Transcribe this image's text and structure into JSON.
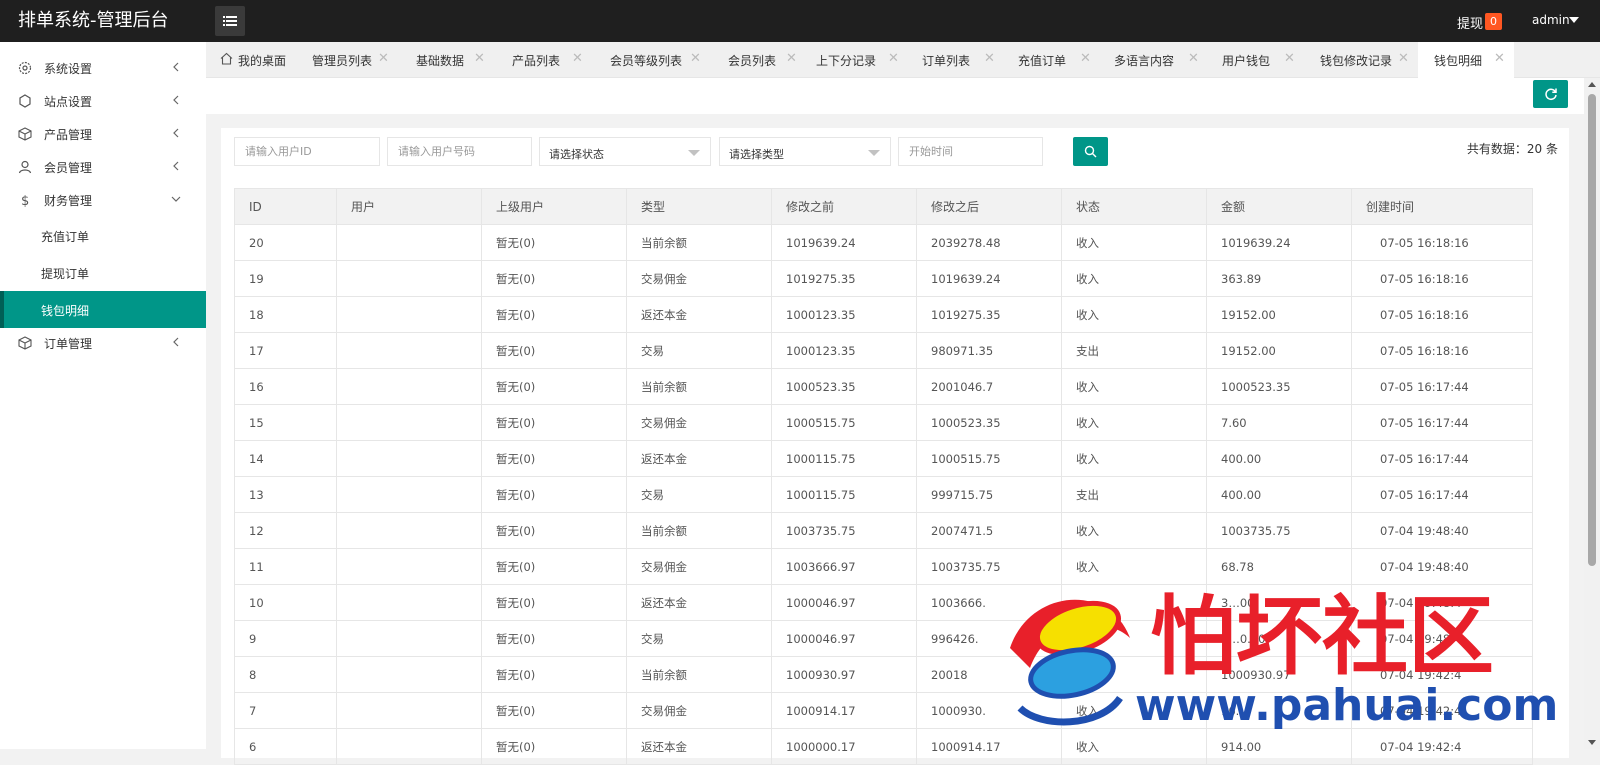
{
  "app": {
    "title": "排单系统-管理后台",
    "withdraw_label": "提现",
    "withdraw_count": "0",
    "user": "admin"
  },
  "sidebar": {
    "items": [
      {
        "label": "系统设置",
        "icon": "gear-icon"
      },
      {
        "label": "站点设置",
        "icon": "site-icon"
      },
      {
        "label": "产品管理",
        "icon": "box-icon"
      },
      {
        "label": "会员管理",
        "icon": "user-icon"
      },
      {
        "label": "财务管理",
        "icon": "dollar-icon"
      },
      {
        "label": "订单管理",
        "icon": "box-icon"
      }
    ],
    "finance_sub": [
      {
        "label": "充值订单"
      },
      {
        "label": "提现订单"
      },
      {
        "label": "钱包明细"
      }
    ]
  },
  "tabs": [
    {
      "label": "我的桌面"
    },
    {
      "label": "管理员列表"
    },
    {
      "label": "基础数据"
    },
    {
      "label": "产品列表"
    },
    {
      "label": "会员等级列表"
    },
    {
      "label": "会员列表"
    },
    {
      "label": "上下分记录"
    },
    {
      "label": "订单列表"
    },
    {
      "label": "充值订单"
    },
    {
      "label": "多语言内容"
    },
    {
      "label": "用户钱包"
    },
    {
      "label": "钱包修改记录"
    },
    {
      "label": "钱包明细"
    }
  ],
  "filters": {
    "user_id_placeholder": "请输入用户ID",
    "user_phone_placeholder": "请输入用户号码",
    "status_select": "请选择状态",
    "type_select": "请选择类型",
    "start_time_placeholder": "开始时间",
    "total_label": "共有数据：",
    "total_value": "20 条"
  },
  "table": {
    "columns": [
      "ID",
      "用户",
      "上级用户",
      "类型",
      "修改之前",
      "修改之后",
      "状态",
      "金额",
      "创建时间"
    ],
    "rows": [
      [
        "20",
        "",
        "暂无(0)",
        "当前余额",
        "1019639.24",
        "2039278.48",
        "收入",
        "1019639.24",
        "07-05 16:18:16"
      ],
      [
        "19",
        "",
        "暂无(0)",
        "交易佣金",
        "1019275.35",
        "1019639.24",
        "收入",
        "363.89",
        "07-05 16:18:16"
      ],
      [
        "18",
        "",
        "暂无(0)",
        "返还本金",
        "1000123.35",
        "1019275.35",
        "收入",
        "19152.00",
        "07-05 16:18:16"
      ],
      [
        "17",
        "",
        "暂无(0)",
        "交易",
        "1000123.35",
        "980971.35",
        "支出",
        "19152.00",
        "07-05 16:18:16"
      ],
      [
        "16",
        "",
        "暂无(0)",
        "当前余额",
        "1000523.35",
        "2001046.7",
        "收入",
        "1000523.35",
        "07-05 16:17:44"
      ],
      [
        "15",
        "",
        "暂无(0)",
        "交易佣金",
        "1000515.75",
        "1000523.35",
        "收入",
        "7.60",
        "07-05 16:17:44"
      ],
      [
        "14",
        "",
        "暂无(0)",
        "返还本金",
        "1000115.75",
        "1000515.75",
        "收入",
        "400.00",
        "07-05 16:17:44"
      ],
      [
        "13",
        "",
        "暂无(0)",
        "交易",
        "1000115.75",
        "999715.75",
        "支出",
        "400.00",
        "07-05 16:17:44"
      ],
      [
        "12",
        "",
        "暂无(0)",
        "当前余额",
        "1003735.75",
        "2007471.5",
        "收入",
        "1003735.75",
        "07-04 19:48:40"
      ],
      [
        "11",
        "",
        "暂无(0)",
        "交易佣金",
        "1003666.97",
        "1003735.75",
        "收入",
        "68.78",
        "07-04 19:48:40"
      ],
      [
        "10",
        "",
        "暂无(0)",
        "返还本金",
        "1000046.97",
        "1003666.",
        "",
        "3…00",
        "07-04 19:48:4"
      ],
      [
        "9",
        "",
        "暂无(0)",
        "交易",
        "1000046.97",
        "996426.",
        "支出",
        "3…0.00",
        "07-04 19:48:4"
      ],
      [
        "8",
        "",
        "暂无(0)",
        "当前余额",
        "1000930.97",
        "20018",
        "",
        "1000930.97",
        "07-04 19:42:4"
      ],
      [
        "7",
        "",
        "暂无(0)",
        "交易佣金",
        "1000914.17",
        "1000930.",
        "收入",
        "16.",
        "07-04 19:42:4"
      ],
      [
        "6",
        "",
        "暂无(0)",
        "返还本金",
        "1000000.17",
        "1000914.17",
        "收入",
        "914.00",
        "07-04 19:42:4"
      ]
    ]
  },
  "watermark": {
    "text_cn": "怕坏社区",
    "url": "www.pahuai.com"
  },
  "colors": {
    "accent": "#009688",
    "topbar": "#1f1f1f",
    "badge": "#ff5722",
    "watermark_red": "#e8202a",
    "watermark_blue": "#1f4fb0"
  }
}
